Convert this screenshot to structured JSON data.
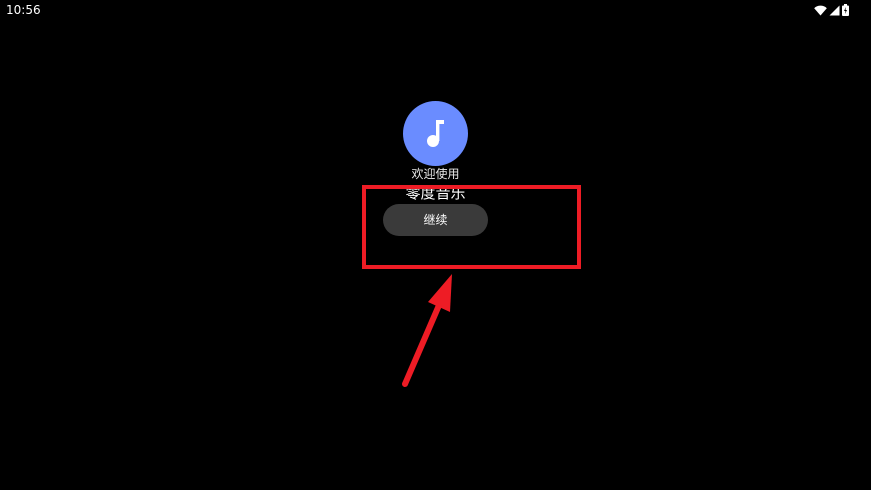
{
  "status_bar": {
    "time": "10:56",
    "icons": [
      "wifi-icon",
      "cell-signal-icon",
      "battery-icon"
    ]
  },
  "welcome": {
    "icon": "music-note-icon",
    "greeting": "欢迎使用",
    "app_name": "零度音乐",
    "continue_label": "继续"
  },
  "colors": {
    "background": "#000000",
    "icon_circle": "#6a8cff",
    "button_bg": "#3a3a3a",
    "annotation": "#ee1c25"
  }
}
